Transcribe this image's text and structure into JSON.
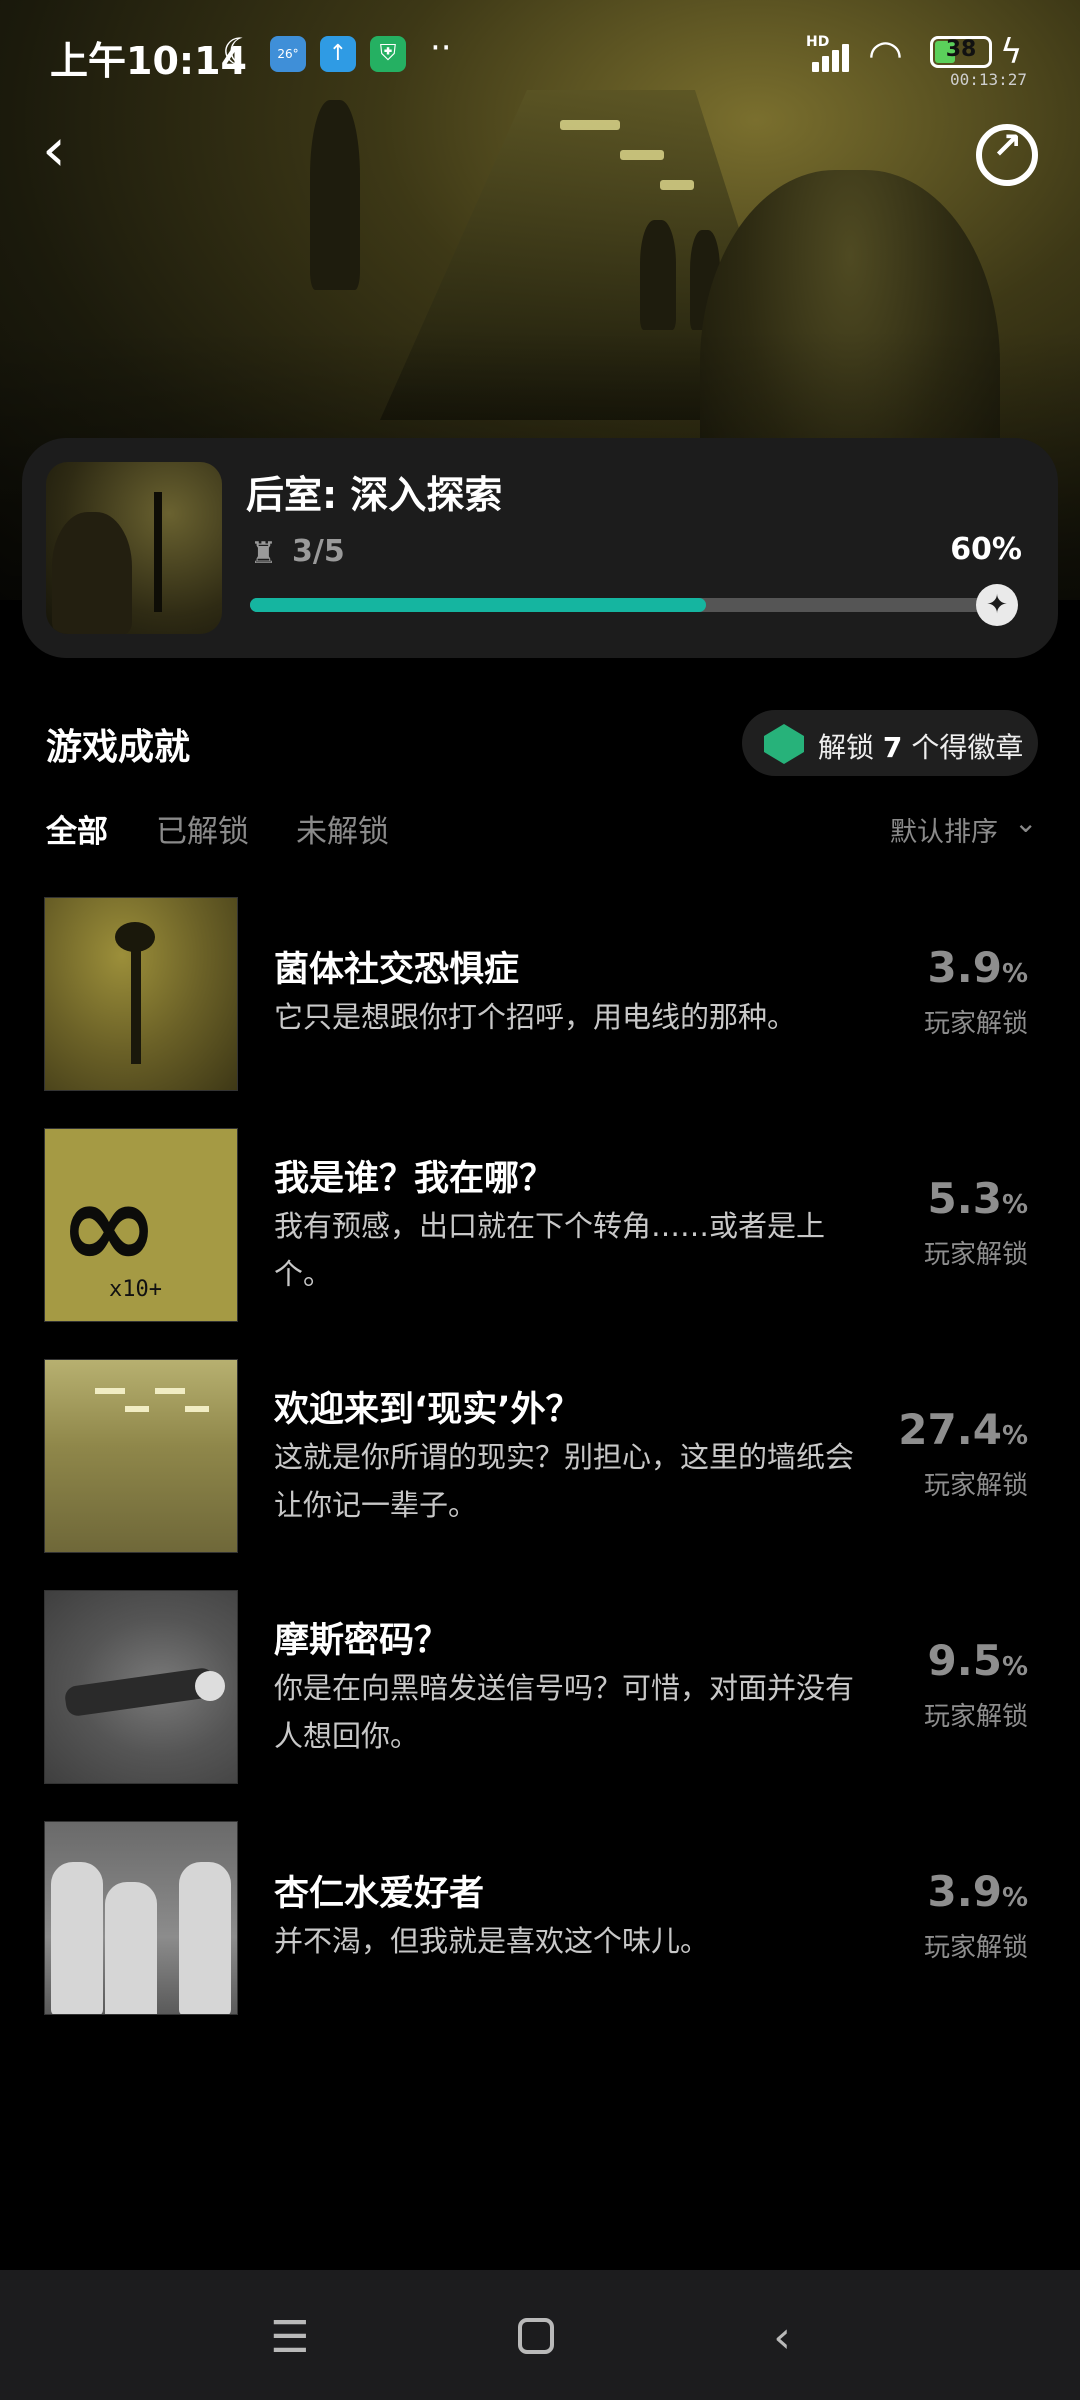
{
  "status_bar": {
    "time": "上午10:14",
    "weather_temp": "26°",
    "hd": "HD",
    "battery": "38",
    "timer": "00:13:27"
  },
  "game": {
    "title": "后室: 深入探索",
    "achievements_progress": "3/5",
    "progress_percent": "60%",
    "progress_value": 0.6
  },
  "section": {
    "title": "游戏成就",
    "badge_prefix": "解锁",
    "badge_count": "7",
    "badge_suffix": "个得徽章"
  },
  "tabs": [
    "全部",
    "已解锁",
    "未解锁"
  ],
  "sort_label": "默认排序",
  "achievements": [
    {
      "name": "菌体社交恐惧症",
      "desc": "它只是想跟你打个招呼，用电线的那种。",
      "rate": "3.9",
      "rate_unit": "%",
      "rate_label": "玩家解锁"
    },
    {
      "name": "我是谁？我在哪？",
      "desc": "我有预感，出口就在下个转角……或者是上个。",
      "rate": "5.3",
      "rate_unit": "%",
      "rate_label": "玩家解锁"
    },
    {
      "name": "欢迎来到‘现实’外？",
      "desc": "这就是你所谓的现实？别担心，这里的墙纸会让你记一辈子。",
      "rate": "27.4",
      "rate_unit": "%",
      "rate_label": "玩家解锁"
    },
    {
      "name": "摩斯密码？",
      "desc": "你是在向黑暗发送信号吗？可惜，对面并没有人想回你。",
      "rate": "9.5",
      "rate_unit": "%",
      "rate_label": "玩家解锁"
    },
    {
      "name": "杏仁水爱好者",
      "desc": "并不渴，但我就是喜欢这个味儿。",
      "rate": "3.9",
      "rate_unit": "%",
      "rate_label": "玩家解锁"
    }
  ],
  "thumb_text": {
    "infinity": "∞",
    "multiplier": "x10+"
  },
  "colors": {
    "accent": "#15b5a0",
    "card_bg": "#1c1c1c",
    "muted": "#8e8e8e"
  }
}
